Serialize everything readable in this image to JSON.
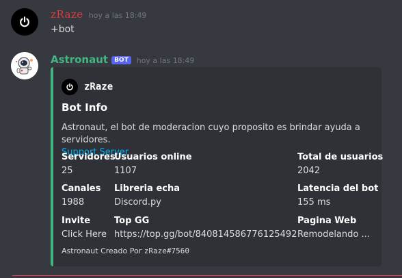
{
  "messages": [
    {
      "author": "zRaze",
      "timestamp": "hoy a las 18:49",
      "content": "+bot"
    },
    {
      "author": "Astronaut",
      "bot_tag": "BOT",
      "timestamp": "hoy a las 18:49",
      "embed": {
        "accent_color": "#43b581",
        "author_name": "zRaze",
        "title": "Bot Info",
        "description": "Astronaut, el bot de moderacion cuyo proposito es brindar ayuda a servidores.",
        "description_link": "Support Server",
        "fields": [
          {
            "name": "Servidores",
            "value": "25"
          },
          {
            "name": "Usuarios online",
            "value": "1107"
          },
          {
            "name": "Total de usuarios",
            "value": "2042"
          },
          {
            "name": "Canales",
            "value": "1988"
          },
          {
            "name": "Libreria echa",
            "value": "Discord.py"
          },
          {
            "name": "Latencia del bot",
            "value": "155 ms"
          },
          {
            "name": "Invite",
            "value": "Click Here"
          },
          {
            "name": "Top GG",
            "value": "https://top.gg/bot/840814586776125492"
          },
          {
            "name": "Pagina Web",
            "value": "Remodelando ..."
          }
        ],
        "footer_prefix": "Astronaut Creado Por",
        "footer_user": "zRaze#7560"
      }
    }
  ],
  "icons": {
    "user_avatar": "power-icon",
    "bot_avatar": "astronaut-icon"
  },
  "colors": {
    "background": "#36393f",
    "embed_bg": "#2f3136",
    "link": "#00aff4",
    "bot_tag": "#5865f2",
    "zraze_name": "#e03b3b",
    "astronaut_name": "#43b581"
  }
}
